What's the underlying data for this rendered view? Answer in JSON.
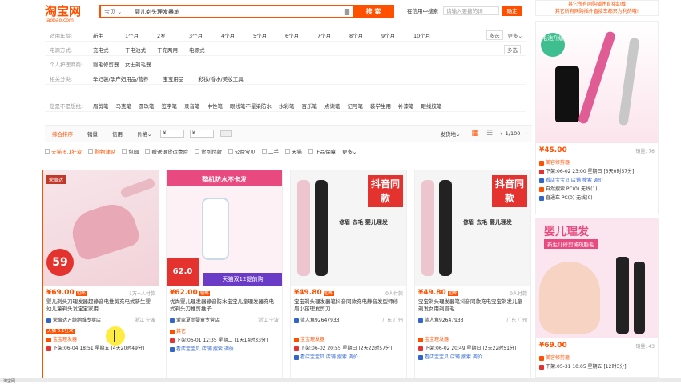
{
  "header": {
    "logo_text": "淘宝网",
    "logo_sub": "Taobao.com",
    "search_type": "宝贝 ⌄",
    "search_query": "婴儿剃头理发器笔",
    "search_button": "搜 索",
    "shop_search_label": "在信用中搜索",
    "shop_search_placeholder": "请输入要搜的词",
    "shop_search_button": "确定",
    "promo_text": "其它所有网购插件直接卸载",
    "promo_text2": "其它所有网购插件直接车都只为利的哦!"
  },
  "filters": [
    {
      "label": "适用年龄:",
      "options": [
        "新生",
        "1个月",
        "2岁",
        "3个月",
        "4个月",
        "5个月",
        "6个月",
        "7个月",
        "8个月",
        "9个月",
        "10个月"
      ],
      "multi": "多选",
      "more": "更多⌄"
    },
    {
      "label": "电源方式:",
      "options": [
        "充电式",
        "干电池式",
        "干充两用",
        "电源式"
      ],
      "multi": "多选",
      "more": ""
    },
    {
      "label": "个人护理商商:",
      "options": [
        "婴毛修剪器",
        "女士剃毛器"
      ],
      "multi": "",
      "more": ""
    },
    {
      "label": "相关分类:",
      "options": [
        "孕妇装/孕产妇用品/营养",
        "宝宝用品",
        "彩妆/香水/美妆工具"
      ],
      "multi": "",
      "more": ""
    },
    {
      "label": "您是不是想找:",
      "options": [
        "眉剪笔",
        "马克笔",
        "圆珠笔",
        "签字笔",
        "录音笔",
        "中性笔",
        "眼线笔不晕染防水",
        "水彩笔",
        "百乐笔",
        "点读笔",
        "记号笔",
        "装学生用",
        "补漆笔",
        "眼线胶笔"
      ],
      "multi": "",
      "more": ""
    }
  ],
  "sort": {
    "options": [
      "综合排序",
      "销量",
      "信用",
      "价格⌄"
    ],
    "price_from": "¥",
    "price_to": "¥",
    "ship_from": "发货地⌄",
    "page": "1/100",
    "prev": "‹",
    "next": "›"
  },
  "checks": [
    "天猫 6.1狂欢",
    "购物津贴",
    "包邮",
    "赠送退货运费险",
    "货到付款",
    "公益宝贝",
    "二手",
    "天猫",
    "正品保障",
    "更多⌄"
  ],
  "products": [
    {
      "price": "¥69.00",
      "tag": "包邮",
      "sold": "1万+人付款",
      "title": "婴儿剃头刀理发器超静音电推剪充电式新生婴幼儿童剃头发宝宝家用",
      "shop": "荣事达万绮纳维专卖店",
      "loc": "浙江 宁波",
      "img_title": "荣事达",
      "img_badge": "59",
      "line1": "宝宝理发器",
      "line2": "下架:06-04 18:51 星期五 [4天20时49分]"
    },
    {
      "price": "¥62.00",
      "tag": "包邮",
      "sold": "",
      "title": "优尚婴儿理发器静音防水宝宝儿童理发器充电式剃头刀推剪推子",
      "shop": "爱家夏尚婴童专营店",
      "loc": "浙江 宁波",
      "img_title": "整机防水不卡发",
      "img_badge": "62.0",
      "img_promo": "天猫双12提前购",
      "line1": "其它",
      "line2": "下架:06-01 12:35 星期二 [1天14时33分]",
      "line3": "看店宝宝贝 店铺 搜索 调价"
    },
    {
      "price": "¥49.80",
      "tag": "包邮",
      "sold": "0人付款",
      "title": "宝宝剃头理发器笔抖音同款充电静音发型师修眉小孩理发剪刀",
      "shop": "篮人鱼92647933",
      "loc": "广东 广州",
      "img_title": "抖音同款",
      "img_sub": "修眉 去毛 婴儿理发",
      "line1": "宝宝理发器",
      "line2": "下架:06-02 20:55 星期日 [2天22时57分]",
      "line3": "看店宝宝贝 店铺 搜索 调价"
    },
    {
      "price": "¥49.80",
      "tag": "包邮",
      "sold": "0人付款",
      "title": "宝宝剃头理发器笔抖音同款充电宝宝剃发儿童剃发女用剃眉毛",
      "shop": "篮人鱼92647933",
      "loc": "广东 广州",
      "img_title": "抖音同款",
      "img_sub": "修眉 去毛 婴儿理发",
      "line1": "宝宝理发器",
      "line2": "下架:06-02 20:49 星期日 [2天22时51分]",
      "line3": "看店宝宝贝 店铺 搜索 调价"
    }
  ],
  "ads": [
    {
      "price": "¥45.00",
      "sold": "销量: 76",
      "img_title": "电池升级",
      "l1": "美容修剪器",
      "l2": "下架:06-02 23:00 星期日 [3天0时57分]",
      "l3": "看店宝宝贝 店铺 搜索 调价",
      "l4": "自然搜索 PC(0) 无线(1)",
      "l5": "直通车 PC(0) 无线(0)"
    },
    {
      "price": "¥69.00",
      "sold": "销量: 43",
      "img_title": "婴儿理发",
      "img_sub": "新生儿修剪稀疏胎毛",
      "l1": "美容修剪器",
      "l2": "下架:05-31 10:05 星期五 [12时3分]"
    }
  ],
  "status": "淘宝网"
}
